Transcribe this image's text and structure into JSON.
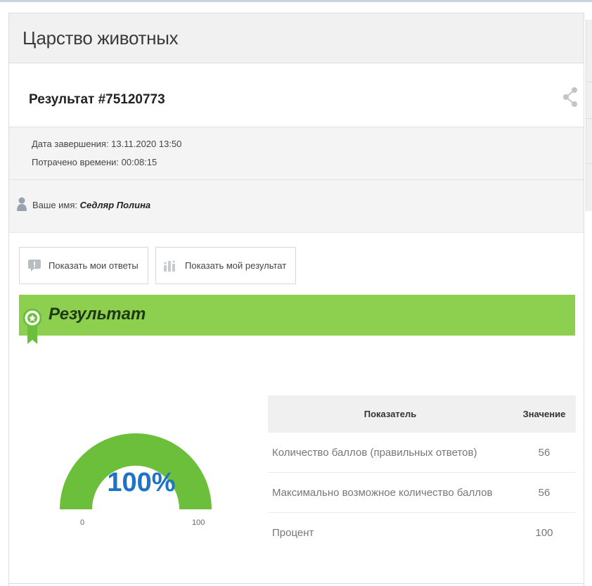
{
  "header": {
    "title": "Царство животных"
  },
  "result": {
    "title": "Результат #75120773"
  },
  "info": {
    "completion": "Дата завершения: 13.11.2020 13:50",
    "time_spent": "Потрачено времени: 00:08:15"
  },
  "user": {
    "name_label": "Ваше имя:",
    "name_value": "Седляр Полина"
  },
  "buttons": {
    "show_answers": "Показать мои ответы",
    "show_result": "Показать мой результат"
  },
  "section": {
    "title": "Результат"
  },
  "gauge": {
    "value_label": "100%",
    "value": 100,
    "min": "0",
    "max": "100",
    "color": "#6cbf3a"
  },
  "table": {
    "headers": [
      "Показатель",
      "Значение"
    ],
    "rows": [
      [
        "Количество баллов (правильных ответов)",
        "56"
      ],
      [
        "Максимально возможное количество баллов",
        "56"
      ],
      [
        "Процент",
        "100"
      ]
    ]
  },
  "colors": {
    "accent_green": "#8dcf4f",
    "gauge_text": "#1f73c4"
  }
}
